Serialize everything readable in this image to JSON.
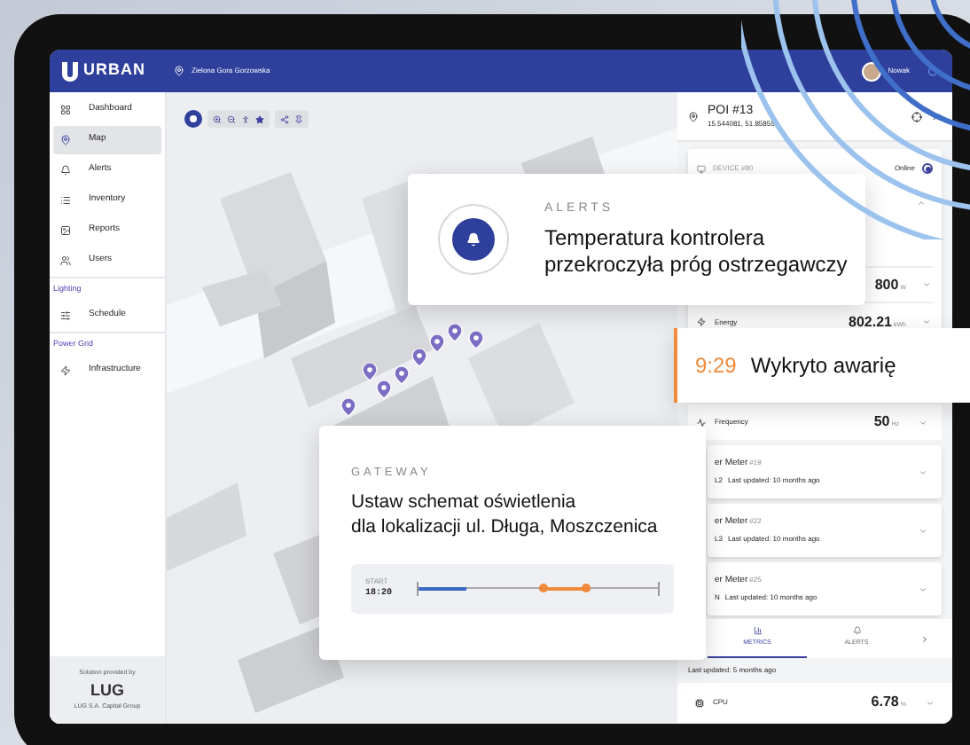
{
  "header": {
    "brand": "URBAN",
    "location": "Zielona Gora Gorzowska",
    "user": "Nowak"
  },
  "sidebar": {
    "items": [
      {
        "kind": "item",
        "label": "Dashboard",
        "selected": false
      },
      {
        "kind": "item",
        "label": "Map",
        "selected": true
      },
      {
        "kind": "item",
        "label": "Alerts",
        "selected": false
      },
      {
        "kind": "item",
        "label": "Inventory",
        "selected": false
      },
      {
        "kind": "item",
        "label": "Reports",
        "selected": false
      },
      {
        "kind": "item",
        "label": "Users",
        "selected": false
      },
      {
        "kind": "section",
        "label": "Lighting"
      },
      {
        "kind": "item",
        "label": "Schedule",
        "selected": false
      },
      {
        "kind": "section",
        "label": "Power Grid"
      },
      {
        "kind": "item",
        "label": "Infrastructure",
        "selected": false
      }
    ],
    "footer": {
      "caption": "Solution provided by",
      "logo": "LUG",
      "company": "LUG S.A. Capital Group"
    }
  },
  "panel": {
    "poi": {
      "title": "POI #13",
      "coordinates": "15.544081, 51.85855"
    },
    "device": {
      "name": "DEVICE #80",
      "status": "Online",
      "online": true,
      "readings": [
        {
          "value": "800",
          "unit": "W"
        },
        {
          "label": "Energy",
          "value": "802.21",
          "unit": "kWh"
        }
      ]
    },
    "readings": [
      {
        "label": "Frequency",
        "value": "50",
        "unit": "Hz"
      }
    ],
    "meters": [
      {
        "title": "er Meter",
        "number": "#19",
        "phase": "L2",
        "updated": "Last updated: 10 months ago"
      },
      {
        "title": "er Meter",
        "number": "#22",
        "phase": "L3",
        "updated": "Last updated: 10 months ago"
      },
      {
        "title": "er Meter",
        "number": "#25",
        "phase": "N",
        "updated": "Last updated: 10 months ago"
      }
    ],
    "tabs": [
      {
        "label": "METRICS",
        "selected": true
      },
      {
        "label": "ALERTS",
        "selected": false
      }
    ],
    "last_updated": "Last updated: 5 months ago",
    "cpu": {
      "label": "CPU",
      "value": "6.78",
      "unit": "%"
    }
  },
  "alert_card": {
    "category": "ALERTS",
    "message": "Temperatura kontrolera\nprzekroczyła próg ostrzegawczy"
  },
  "notification": {
    "time": "9:29",
    "text": "Wykryto awarię"
  },
  "gateway_card": {
    "category": "GATEWAY",
    "message": "Ustaw schemat oświetlenia\ndla lokalizacji ul. Długa, Moszczenica",
    "schedule": {
      "label": "START",
      "time": "18:20",
      "level": 0.2
    }
  }
}
